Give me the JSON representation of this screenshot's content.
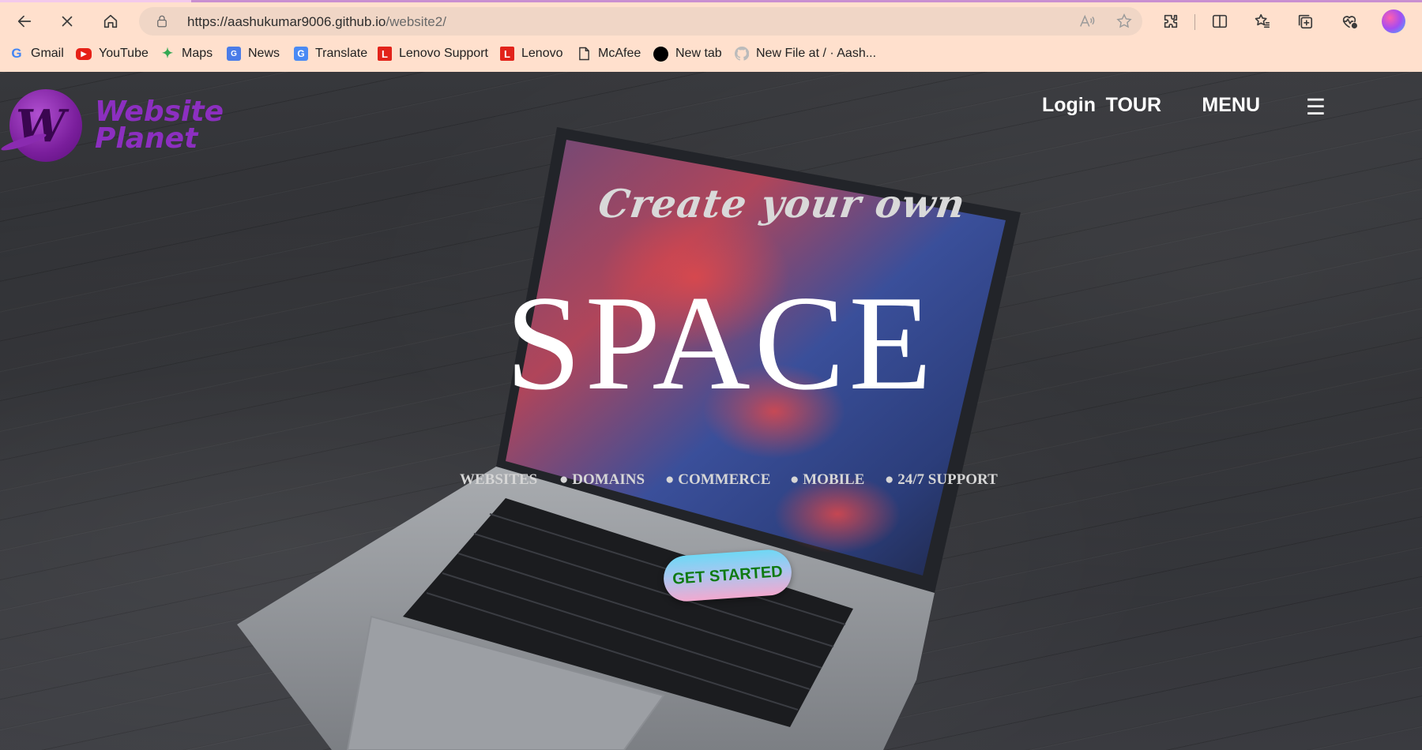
{
  "browser": {
    "url_host": "https://aashukumar9006.github.io",
    "url_path": "/website2/",
    "bookmarks": [
      {
        "label": "Gmail",
        "icon": "gmail-g-icon"
      },
      {
        "label": "YouTube",
        "icon": "youtube-icon"
      },
      {
        "label": "Maps",
        "icon": "maps-pin-icon"
      },
      {
        "label": "News",
        "icon": "news-icon"
      },
      {
        "label": "Translate",
        "icon": "translate-icon"
      },
      {
        "label": "Lenovo Support",
        "icon": "lenovo-icon"
      },
      {
        "label": "Lenovo",
        "icon": "lenovo-icon"
      },
      {
        "label": "McAfee",
        "icon": "page-icon"
      },
      {
        "label": "New tab",
        "icon": "black-circle-icon"
      },
      {
        "label": "New File at / · Aash...",
        "icon": "github-icon"
      }
    ]
  },
  "site": {
    "logo_text": "Website Planet",
    "nav": {
      "login": "Login",
      "tour": "TOUR",
      "menu": "MENU",
      "hamburger": "☰"
    },
    "tagline": "Create your own",
    "headline": "SPACE",
    "features": [
      "WEBSITES",
      "● DOMAINS",
      "● COMMERCE",
      "● MOBILE",
      "● 24/7 SUPPORT"
    ],
    "cta": "GET STARTED"
  },
  "colors": {
    "chrome_bg": "#ffe0cd",
    "logo_purple": "#8c2fc0",
    "cta_text": "#0f7a12"
  }
}
